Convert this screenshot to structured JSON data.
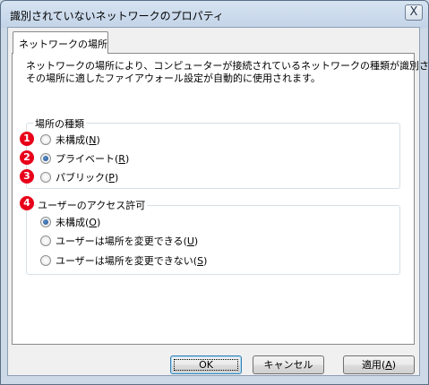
{
  "window": {
    "title": "識別されていないネットワークのプロパティ",
    "close_label": "X"
  },
  "tab": {
    "label": "ネットワークの場所"
  },
  "description": [
    "ネットワークの場所により、コンピューターが接続されているネットワークの種類が識別され、",
    "その場所に適したファイアウォール設定が自動的に使用されます。"
  ],
  "location_type": {
    "legend": "場所の種類",
    "options": [
      {
        "label": "未構成",
        "hotkey": "N",
        "checked": false,
        "badge": "1"
      },
      {
        "label": "プライベート",
        "hotkey": "R",
        "checked": true,
        "badge": "2"
      },
      {
        "label": "パブリック",
        "hotkey": "P",
        "checked": false,
        "badge": "3"
      }
    ]
  },
  "user_access": {
    "legend": "ユーザーのアクセス許可",
    "badge": "4",
    "options": [
      {
        "label": "未構成",
        "hotkey": "O",
        "checked": true
      },
      {
        "label": "ユーザーは場所を変更できる",
        "hotkey": "U",
        "checked": false
      },
      {
        "label": "ユーザーは場所を変更できない",
        "hotkey": "S",
        "checked": false
      }
    ]
  },
  "buttons": {
    "ok": "OK",
    "cancel": "キャンセル",
    "apply_label": "適用",
    "apply_hotkey": "A"
  },
  "colors": {
    "badge": "#e8001a",
    "radio_checked": "#1e4f8f"
  }
}
